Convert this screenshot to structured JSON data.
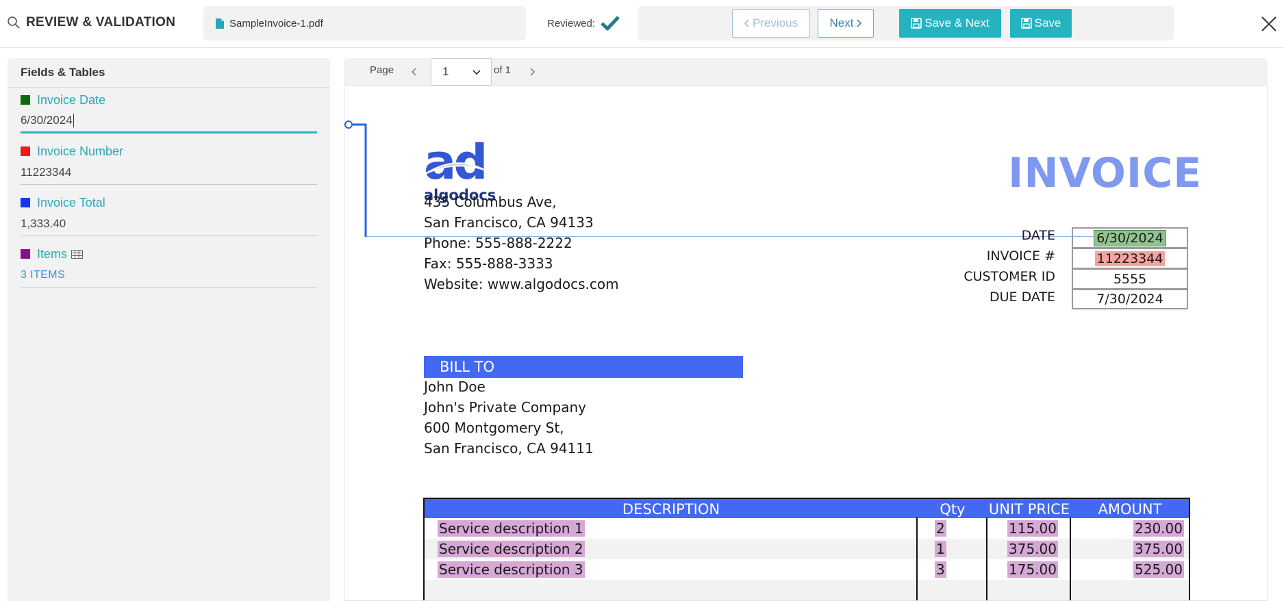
{
  "header": {
    "title": "REVIEW & VALIDATION",
    "file_name": "SampleInvoice-1.pdf",
    "reviewed_label": "Reviewed:",
    "buttons": {
      "previous": "Previous",
      "next": "Next",
      "save_next": "Save & Next",
      "save": "Save"
    }
  },
  "panel": {
    "title": "Fields & Tables",
    "fields": [
      {
        "label": "Invoice Date",
        "value": "6/30/2024",
        "color": "#0b6b0b"
      },
      {
        "label": "Invoice Number",
        "value": "11223344",
        "color": "#f01818"
      },
      {
        "label": "Invoice Total",
        "value": "1,333.40",
        "color": "#1238f0"
      },
      {
        "label": "Items",
        "value": "3 ITEMS",
        "color": "#8a0f8a"
      }
    ]
  },
  "viewer": {
    "page_label": "Page",
    "page_value": "1",
    "page_of": "of 1"
  },
  "invoice": {
    "logo_mark": "ad",
    "logo_name": "algodocs",
    "heading": "INVOICE",
    "address": [
      "435 Columbus Ave,",
      "San Francisco, CA 94133",
      "Phone: 555-888-2222",
      "Fax: 555-888-3333",
      "Website: www.algodocs.com"
    ],
    "meta": [
      {
        "label": "DATE",
        "value": "6/30/2024"
      },
      {
        "label": "INVOICE #",
        "value": "11223344"
      },
      {
        "label": "CUSTOMER ID",
        "value": "5555"
      },
      {
        "label": "DUE DATE",
        "value": "7/30/2024"
      }
    ],
    "bill_to_title": "BILL TO",
    "bill_to": [
      "John Doe",
      "John's Private Company",
      "600 Montgomery St,",
      "San Francisco, CA 94111"
    ],
    "table_headers": [
      "DESCRIPTION",
      "Qty",
      "UNIT PRICE",
      "AMOUNT"
    ],
    "rows": [
      {
        "description": "Service description 1",
        "qty": "2",
        "unit_price": "115.00",
        "amount": "230.00"
      },
      {
        "description": "Service description 2",
        "qty": "1",
        "unit_price": "375.00",
        "amount": "375.00"
      },
      {
        "description": "Service description 3",
        "qty": "3",
        "unit_price": "175.00",
        "amount": "525.00"
      }
    ]
  },
  "colors": {
    "accent": "#26b3c0",
    "link": "#3d7eb3",
    "invoice_blue": "#4468f2",
    "connector_line": "#2266dd"
  }
}
